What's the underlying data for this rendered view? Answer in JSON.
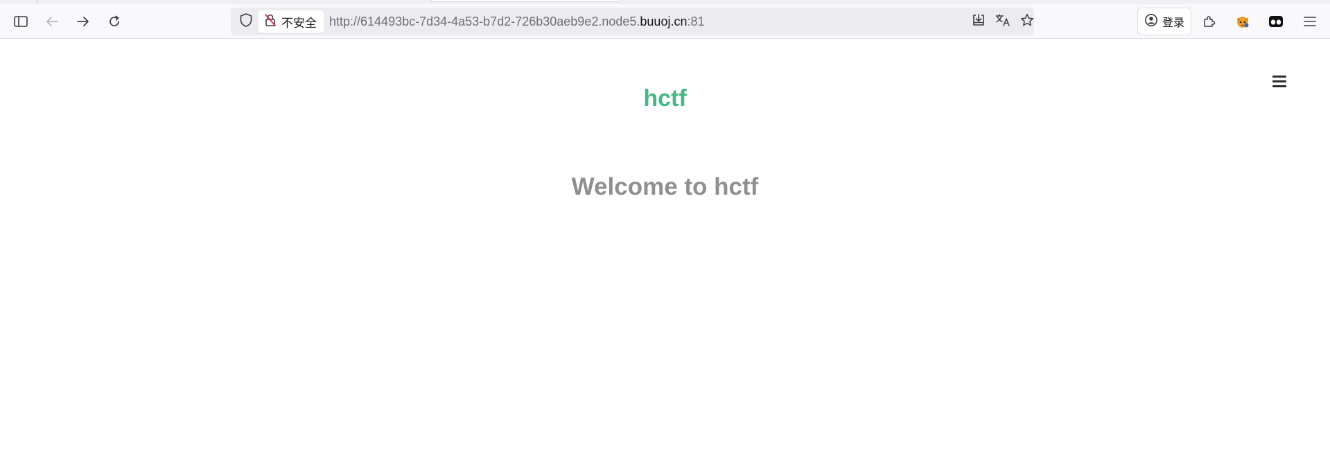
{
  "browser": {
    "security_label": "不安全",
    "url": {
      "prefix": "http://614493bc-7d34-4a53-b7d2-726b30aeb9e2.node5.",
      "domain": "buuoj.cn",
      "suffix": ":81"
    },
    "login_label": "登录",
    "icons": {
      "sidebar": "sidebar-icon",
      "back": "back-arrow-icon",
      "forward": "forward-arrow-icon",
      "reload": "reload-icon",
      "tracking": "shield-icon",
      "insecure": "insecure-lock-icon",
      "install": "install-app-icon",
      "translate": "translate-icon",
      "bookmark": "star-icon",
      "account": "account-icon",
      "extensions": "puzzle-icon",
      "extension_fox": "fox-extension-icon",
      "extension_mask": "mask-extension-icon",
      "app_menu": "hamburger-icon"
    }
  },
  "page": {
    "title": "hctf",
    "heading": "Welcome to hctf",
    "title_color": "#42b983",
    "heading_color": "#8f8f8f"
  }
}
